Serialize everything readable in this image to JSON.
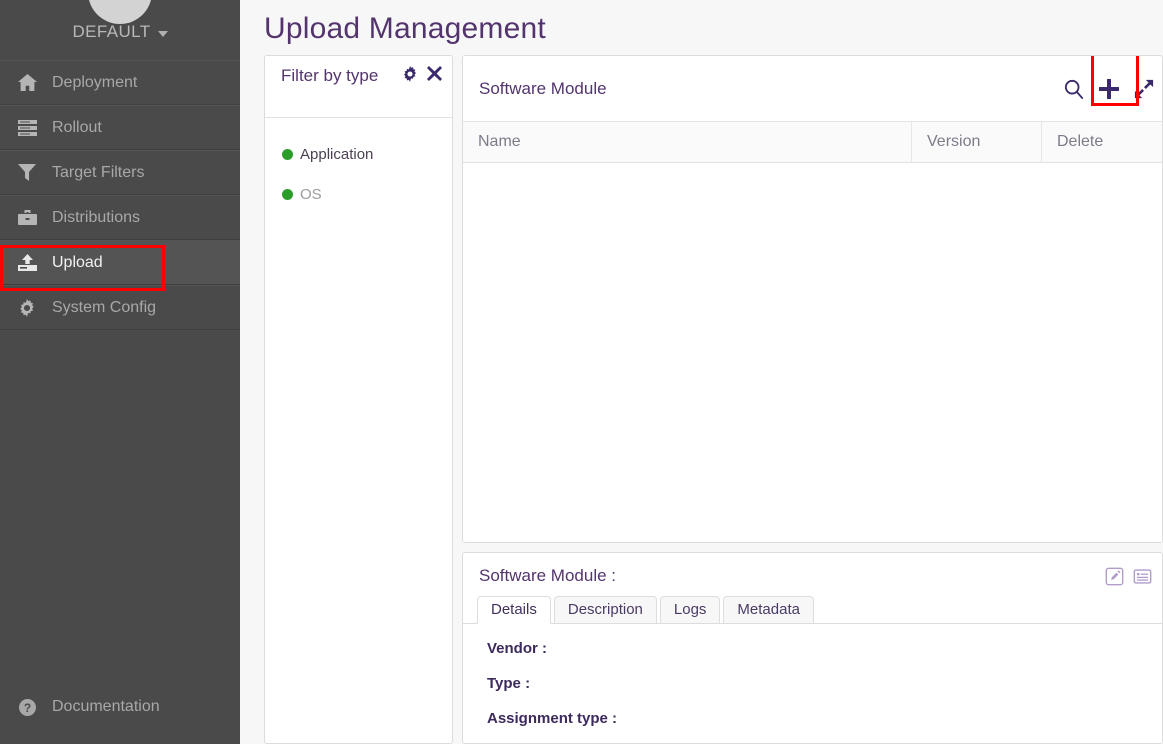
{
  "sidebar": {
    "tenant": "DEFAULT",
    "tenant_chevron_icon": "chevron-down-icon",
    "avatar_icon": "avatar",
    "items": [
      {
        "label": "Deployment",
        "icon": "home-icon",
        "active": false
      },
      {
        "label": "Rollout",
        "icon": "rollout-list-icon",
        "active": false
      },
      {
        "label": "Target Filters",
        "icon": "funnel-icon",
        "active": false
      },
      {
        "label": "Distributions",
        "icon": "briefcase-icon",
        "active": false
      },
      {
        "label": "Upload",
        "icon": "upload-icon",
        "active": true
      },
      {
        "label": "System Config",
        "icon": "gear-icon",
        "active": false
      }
    ],
    "documentation": {
      "label": "Documentation",
      "icon": "question-circle-icon"
    }
  },
  "header": {
    "title": "Upload Management"
  },
  "filter_panel": {
    "title": "Filter by type",
    "config_icon": "gear-icon",
    "close_icon": "close-icon",
    "items": [
      {
        "label": "Application",
        "color": "#2a9d2a",
        "selected": true
      },
      {
        "label": "OS",
        "color": "#2a9d2a",
        "selected": false
      }
    ]
  },
  "table_panel": {
    "title": "Software Module",
    "actions": [
      {
        "name": "search-icon",
        "label": "Search"
      },
      {
        "name": "add-icon",
        "label": "+"
      },
      {
        "name": "maximize-icon",
        "label": "Maximize"
      }
    ],
    "columns": [
      "Name",
      "Version",
      "Delete"
    ],
    "rows": []
  },
  "detail_panel": {
    "title": "Software Module :",
    "icons": [
      {
        "name": "edit-icon",
        "label": "Edit"
      },
      {
        "name": "description-list-icon",
        "label": "Details"
      }
    ],
    "tabs": [
      {
        "label": "Details",
        "active": true
      },
      {
        "label": "Description",
        "active": false
      },
      {
        "label": "Logs",
        "active": false
      },
      {
        "label": "Metadata",
        "active": false
      }
    ],
    "fields": [
      {
        "label": "Vendor :",
        "value": ""
      },
      {
        "label": "Type :",
        "value": ""
      },
      {
        "label": "Assignment type :",
        "value": ""
      }
    ]
  },
  "highlights": {
    "upload_nav": "#ff0000",
    "add_button": "#ff0000"
  },
  "colors": {
    "sidebar_bg": "#4a4a4a",
    "accent_purple": "#53346d",
    "icon_purple": "#3b2a6b",
    "green_dot": "#2a9d2a",
    "page_bg": "#f7f7f7"
  }
}
